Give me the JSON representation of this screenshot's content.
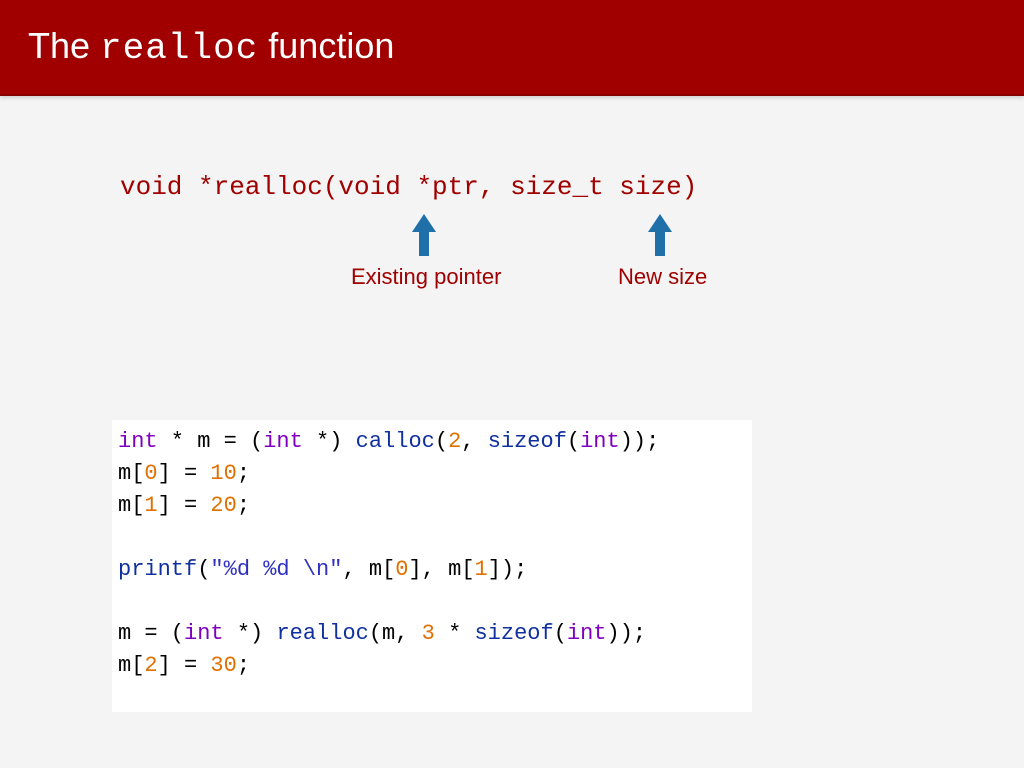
{
  "title": {
    "prefix": "The ",
    "mono": "realloc",
    "suffix": " function"
  },
  "signature": "void *realloc(void *ptr, size_t size)",
  "annotations": {
    "ptr": "Existing pointer",
    "size": "New size"
  },
  "code": {
    "l1_a": "int",
    "l1_b": " * m = (",
    "l1_c": "int",
    "l1_d": " *) ",
    "l1_e": "calloc",
    "l1_f": "(",
    "l1_g": "2",
    "l1_h": ", ",
    "l1_i": "sizeof",
    "l1_j": "(",
    "l1_k": "int",
    "l1_l": "));",
    "l2_a": "m[",
    "l2_b": "0",
    "l2_c": "] = ",
    "l2_d": "10",
    "l2_e": ";",
    "l3_a": "m[",
    "l3_b": "1",
    "l3_c": "] = ",
    "l3_d": "20",
    "l3_e": ";",
    "l5_a": "printf",
    "l5_b": "(",
    "l5_c": "\"%d %d \\n\"",
    "l5_d": ", m[",
    "l5_e": "0",
    "l5_f": "], m[",
    "l5_g": "1",
    "l5_h": "]);",
    "l7_a": "m = (",
    "l7_b": "int",
    "l7_c": " *) ",
    "l7_d": "realloc",
    "l7_e": "(m, ",
    "l7_f": "3",
    "l7_g": " * ",
    "l7_h": "sizeof",
    "l7_i": "(",
    "l7_j": "int",
    "l7_k": "));",
    "l8_a": "m[",
    "l8_b": "2",
    "l8_c": "] = ",
    "l8_d": "30",
    "l8_e": ";"
  }
}
